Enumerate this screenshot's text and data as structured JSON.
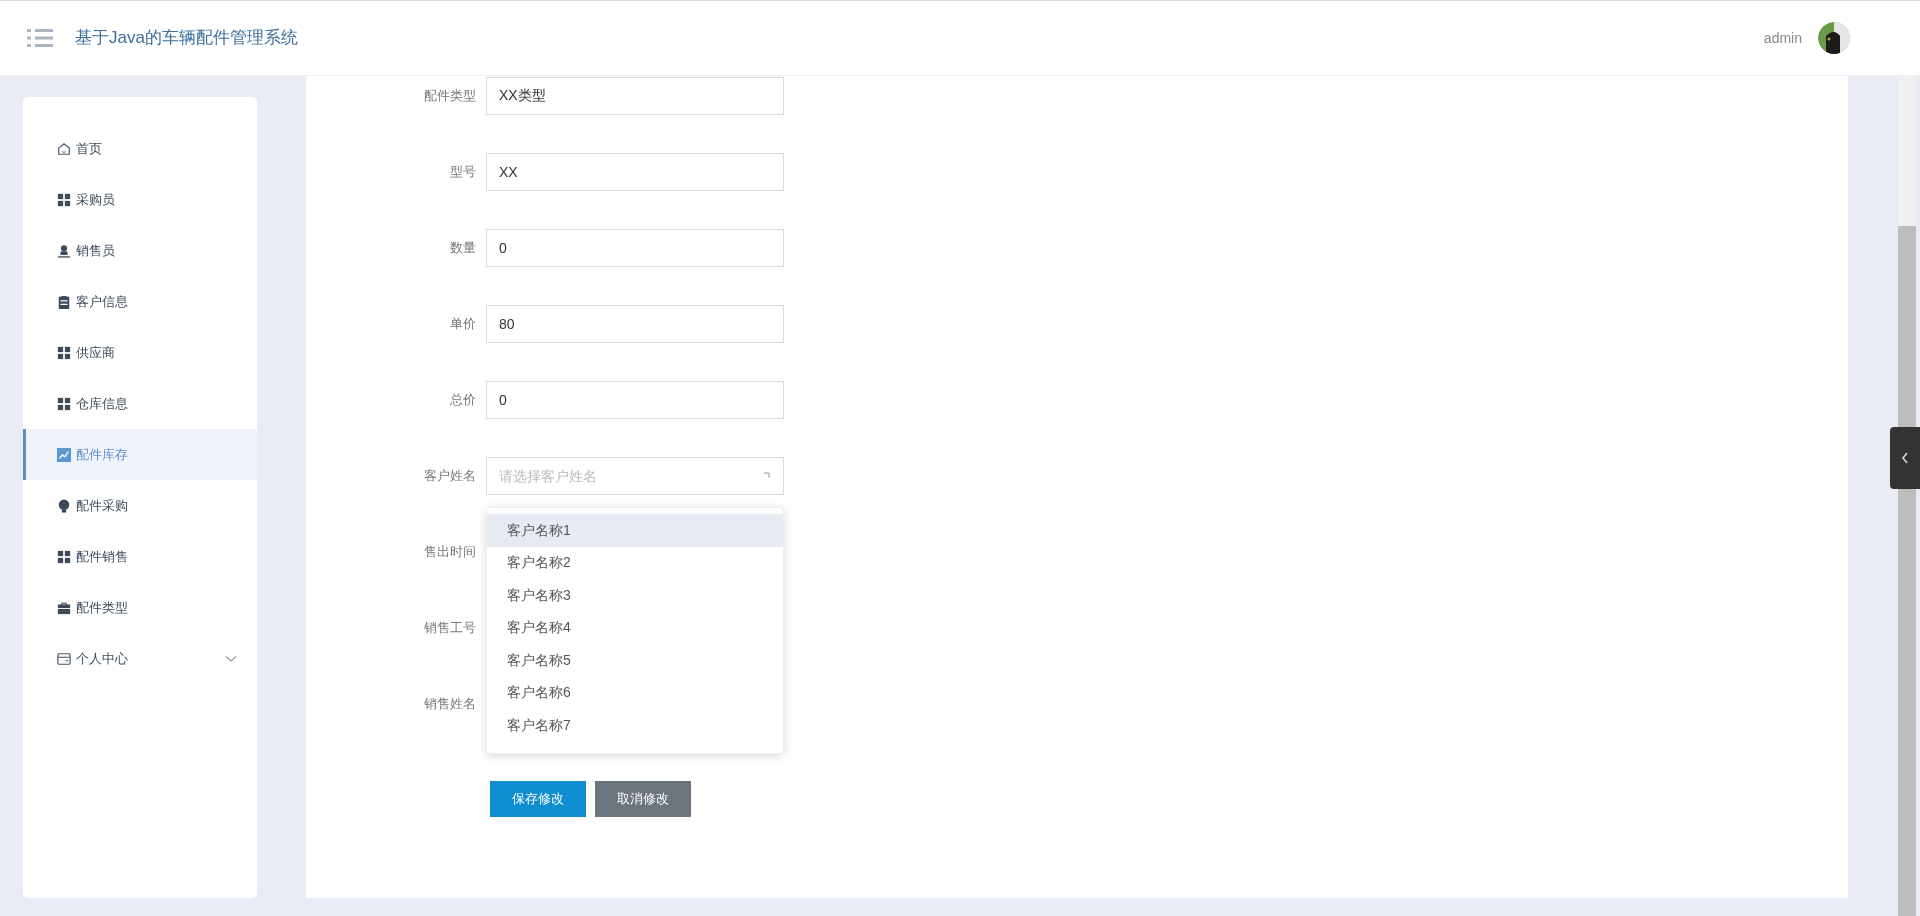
{
  "header": {
    "title": "基于Java的车辆配件管理系统",
    "user": "admin"
  },
  "sidebar": {
    "items": [
      {
        "label": "首页",
        "kind": "home",
        "selected": false
      },
      {
        "label": "采购员",
        "kind": "grid",
        "selected": false
      },
      {
        "label": "销售员",
        "kind": "user",
        "selected": false
      },
      {
        "label": "客户信息",
        "kind": "clipboard",
        "selected": false
      },
      {
        "label": "供应商",
        "kind": "grid",
        "selected": false
      },
      {
        "label": "仓库信息",
        "kind": "grid",
        "selected": false
      },
      {
        "label": "配件库存",
        "kind": "chart",
        "selected": true
      },
      {
        "label": "配件采购",
        "kind": "bulb",
        "selected": false
      },
      {
        "label": "配件销售",
        "kind": "grid",
        "selected": false
      },
      {
        "label": "配件类型",
        "kind": "briefcase",
        "selected": false
      },
      {
        "label": "个人中心",
        "kind": "card",
        "selected": false,
        "expanded": false
      }
    ]
  },
  "form": {
    "fields": [
      {
        "kind": "text",
        "label": "配件类型",
        "value": "XX类型"
      },
      {
        "kind": "text",
        "label": "型号",
        "value": "XX"
      },
      {
        "kind": "text",
        "label": "数量",
        "value": "0"
      },
      {
        "kind": "text",
        "label": "单价",
        "value": "80"
      },
      {
        "kind": "text",
        "label": "总价",
        "value": "0"
      },
      {
        "kind": "select",
        "label": "客户姓名",
        "placeholder": "请选择客户姓名",
        "open": true,
        "options": [
          {
            "label": "客户名称1",
            "highlighted": true
          },
          {
            "label": "客户名称2",
            "highlighted": false
          },
          {
            "label": "客户名称3",
            "highlighted": false
          },
          {
            "label": "客户名称4",
            "highlighted": false
          },
          {
            "label": "客户名称5",
            "highlighted": false
          },
          {
            "label": "客户名称6",
            "highlighted": false
          },
          {
            "label": "客户名称7",
            "highlighted": false
          }
        ]
      },
      {
        "kind": "covered",
        "label": "售出时间"
      },
      {
        "kind": "covered",
        "label": "销售工号"
      },
      {
        "kind": "covered",
        "label": "销售姓名"
      }
    ],
    "buttons": [
      {
        "kind": "primary",
        "label": "保存修改"
      },
      {
        "kind": "secondary",
        "label": "取消修改"
      }
    ]
  }
}
